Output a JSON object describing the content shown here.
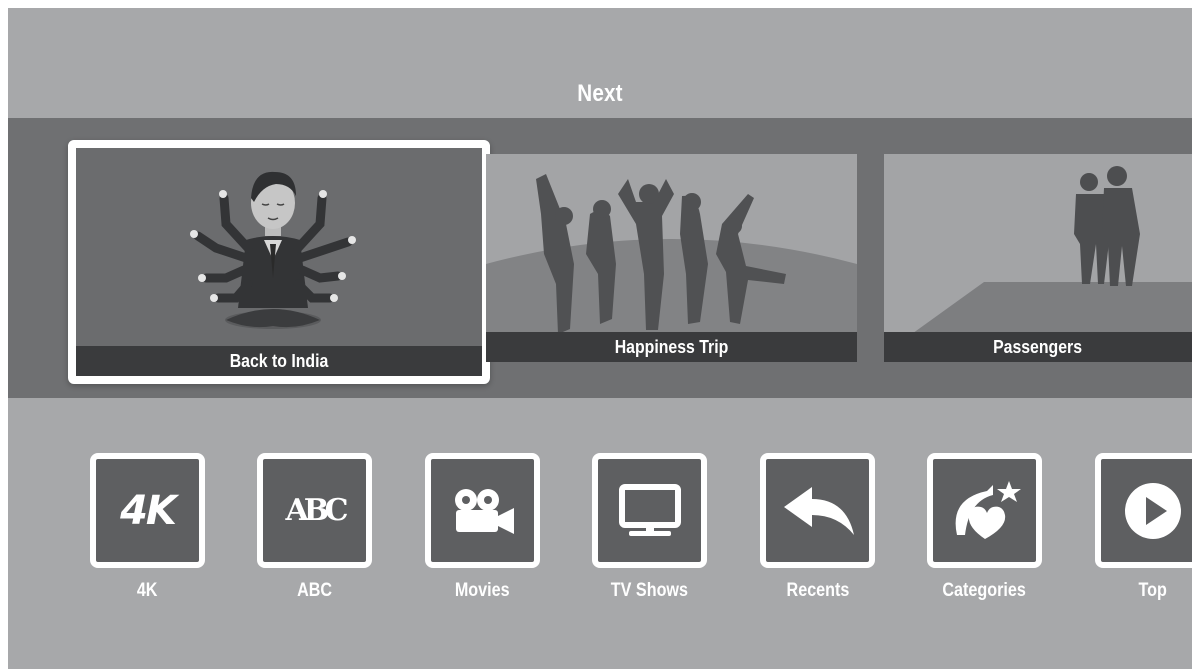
{
  "section": {
    "title": "Next"
  },
  "featured": [
    {
      "title": "Back to India",
      "focused": true
    },
    {
      "title": "Happiness Trip",
      "focused": false
    },
    {
      "title": "Passengers",
      "focused": false
    }
  ],
  "categories": [
    {
      "label": "4K",
      "icon": "4k-icon",
      "glyph": "4K"
    },
    {
      "label": "ABC",
      "icon": "abc-icon",
      "glyph": "ABC"
    },
    {
      "label": "Movies",
      "icon": "movie-camera-icon"
    },
    {
      "label": "TV Shows",
      "icon": "tv-icon"
    },
    {
      "label": "Recents",
      "icon": "back-arrow-icon"
    },
    {
      "label": "Categories",
      "icon": "heart-star-icon"
    },
    {
      "label": "Top",
      "icon": "play-icon"
    }
  ],
  "colors": {
    "background": "#a7a8aa",
    "shelf": "#6f7072",
    "tile": "#5e5f61",
    "label_bar": "#3a3b3d",
    "focus_border": "#ffffff"
  }
}
